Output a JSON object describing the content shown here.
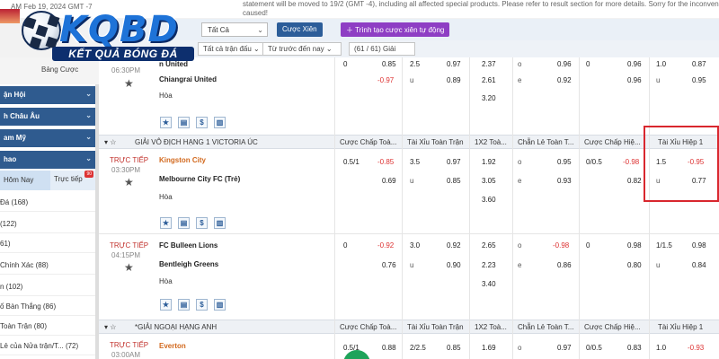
{
  "notice": {
    "time": "AM Feb 19, 2024 GMT -7",
    "message_line1": "statement will be moved to 19/2 (GMT -4), including all affected special products. Please refer to result section for more details. Sorry for the inconvenience",
    "message_line2": "caused!"
  },
  "logo": {
    "brand": "KQBD",
    "slogan": "KẾT QUẢ BÓNG ĐÁ"
  },
  "filters": {
    "sport": "Tất Cả",
    "parlay_button": "Cược Xiên",
    "auto_parlay_button": "Trình tạo cược xiên tự động",
    "match_select": "Tất cả trận đấu",
    "sort_select": "Từ trước đến nay",
    "league_count": "(61 / 61) Giải"
  },
  "sidebar": {
    "bet_label": "Bảng Cược",
    "categories": [
      "ận Hội",
      "h Châu Âu",
      "am Mỹ",
      "hao"
    ],
    "tab_today": "Hôm Nay",
    "tab_live": "Trực tiếp",
    "tab_live_badge": "90",
    "items": [
      "Đá (168)",
      "(122)",
      "61)",
      "Chính Xác (88)",
      "n (102)",
      "ố Bàn Thắng (86)",
      "Toàn Trận (80)",
      "Lẻ của Nửa trận/T... (72)"
    ]
  },
  "columns": {
    "handicap_ft": "Cược Chấp Toà...",
    "ou_ft": "Tài Xỉu Toàn Trận",
    "x12_ft": "1X2 Toà...",
    "oe_ft": "Chẵn Lẻ Toàn T...",
    "handicap_h1": "Cược Chấp Hiệ...",
    "ou_h1": "Tài Xỉu Hiệp 1"
  },
  "match0": {
    "time": "06:30PM",
    "home": "n United",
    "away": "Chiangrai United",
    "draw": "Hòa",
    "r1": {
      "hcp_line": "0",
      "hcp_odd": "0.85",
      "ou_line": "2.5",
      "ou_odd": "0.97",
      "x12": "2.37",
      "oe_label": "o",
      "oe_odd": "0.96",
      "h1_hcp_line": "0",
      "h1_hcp_odd": "0.96",
      "h1_ou_line": "1.0",
      "h1_ou_odd": "0.87"
    },
    "r2": {
      "hcp_odd": "-0.97",
      "ou_label": "u",
      "ou_odd": "0.89",
      "x12": "2.61",
      "oe_label": "e",
      "oe_odd": "0.92",
      "h1_hcp_odd": "0.96",
      "h1_ou_label": "u",
      "h1_ou_odd": "0.95"
    },
    "r3": {
      "x12": "3.20"
    }
  },
  "league1": {
    "name": "GIẢI VÔ ĐỊCH HẠNG 1 VICTORIA ÚC"
  },
  "match1": {
    "live": "TRỰC TIẾP",
    "time": "03:30PM",
    "home": "Kingston City",
    "away": "Melbourne City FC (Trẻ)",
    "draw": "Hòa",
    "r1": {
      "hcp_line": "0.5/1",
      "hcp_odd": "-0.85",
      "ou_line": "3.5",
      "ou_odd": "0.97",
      "x12": "1.92",
      "oe_label": "o",
      "oe_odd": "0.95",
      "h1_hcp_line": "0/0.5",
      "h1_hcp_odd": "-0.98",
      "h1_ou_line": "1.5",
      "h1_ou_odd": "-0.95"
    },
    "r2": {
      "hcp_odd": "0.69",
      "ou_label": "u",
      "ou_odd": "0.85",
      "x12": "3.05",
      "oe_label": "e",
      "oe_odd": "0.93",
      "h1_hcp_odd": "0.82",
      "h1_ou_label": "u",
      "h1_ou_odd": "0.77"
    },
    "r3": {
      "x12": "3.60"
    }
  },
  "match2": {
    "live": "TRỰC TIẾP",
    "time": "04:15PM",
    "home": "FC Bulleen Lions",
    "away": "Bentleigh Greens",
    "draw": "Hòa",
    "r1": {
      "hcp_line": "0",
      "hcp_odd": "-0.92",
      "ou_line": "3.0",
      "ou_odd": "0.92",
      "x12": "2.65",
      "oe_label": "o",
      "oe_odd": "-0.98",
      "h1_hcp_line": "0",
      "h1_hcp_odd": "0.98",
      "h1_ou_line": "1/1.5",
      "h1_ou_odd": "0.98"
    },
    "r2": {
      "hcp_odd": "0.76",
      "ou_label": "u",
      "ou_odd": "0.90",
      "x12": "2.23",
      "oe_label": "e",
      "oe_odd": "0.86",
      "h1_hcp_odd": "0.80",
      "h1_ou_label": "u",
      "h1_ou_odd": "0.84"
    },
    "r3": {
      "x12": "3.40"
    }
  },
  "league2": {
    "name": "*GIẢI NGOẠI HẠNG ANH"
  },
  "match3": {
    "live": "TRỰC TIẾP",
    "time": "03:00AM",
    "home": "Everton",
    "r1": {
      "hcp_line": "0.5/1",
      "hcp_odd": "0.88",
      "ou_line": "2/2.5",
      "ou_odd": "0.85",
      "x12": "1.69",
      "oe_label": "o",
      "oe_odd": "0.97",
      "h1_hcp_line": "0/0.5",
      "h1_hcp_odd": "0.83",
      "h1_ou_line": "1.0",
      "h1_ou_odd": "-0.93"
    }
  },
  "colors": {
    "accent": "#2c5d99",
    "live": "#c2322d",
    "negative": "#dd3333",
    "highlight": "#d9272e",
    "purple": "#8e3ec4"
  }
}
